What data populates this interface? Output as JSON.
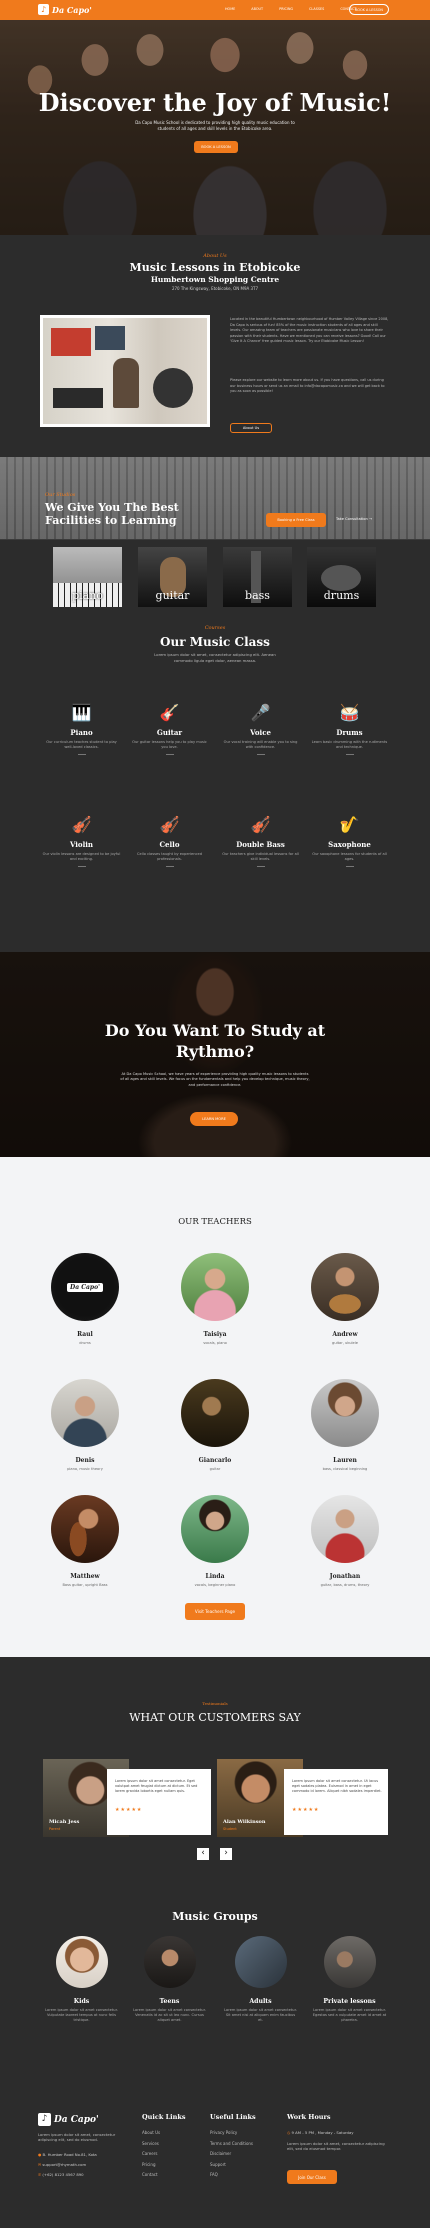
{
  "nav": {
    "logo": "Da Capo'",
    "items": [
      "HOME",
      "ABOUT",
      "PRICING",
      "CLASSES",
      "CONTACT"
    ],
    "cta": "BOOK A LESSON"
  },
  "hero": {
    "title": "Discover the Joy of Music!",
    "subtitle": "Da Capo Music School is dedicated to providing high quality music education to students of all ages and skill levels in the Etobicoke area.",
    "button": "BOOK A LESSON"
  },
  "lessons": {
    "kicker": "About Us",
    "title": "Music Lessons in Etobicoke",
    "subtitle": "Humbertown Shopping Centre",
    "address": "270 The Kingsway, Etobicoke, ON M9A 3T7",
    "para1": "Located in the beautiful Humbertown neighbourhood of Humber Valley Village since 2008, Da Capo is serious of fun! 85% of the music instruction students of all ages and skill levels. Our amazing team of teachers are passionate musicians who love to share their passion with their students. Have we mentioned you can receive lessons? Good! Call our 'Give It A Chance' free guided music lesson. Try our Etobicoke Music Lesson!",
    "para2": "Please explore our website to learn more about us. If you have questions, call us during our business hours or send us an email to info@dacapomusic.ca and we will get back to you as soon as possible!",
    "button": "About Us"
  },
  "facilities": {
    "kicker": "Our Studios",
    "title": "We Give You The Best Facilities to Learning",
    "button": "Booking a Free Class",
    "link": "Take Consultation",
    "cards": [
      "piano",
      "guitar",
      "bass",
      "drums"
    ]
  },
  "music_class": {
    "kicker": "Courses",
    "title": "Our Music Class",
    "desc": "Lorem ipsum dolor sit amet, consectetur adipiscing elit. Aenean commodo ligula eget dolor, aenean massa.",
    "items": [
      {
        "name": "Piano",
        "desc": "Our curriculum teaches student to play well-loved classics.",
        "icon": "piano-icon",
        "glyph": "🎹"
      },
      {
        "name": "Guitar",
        "desc": "Our guitar lessons help you to play music you love.",
        "icon": "guitar-icon",
        "glyph": "🎸"
      },
      {
        "name": "Voice",
        "desc": "Our vocal training will enable you to sing with confidence.",
        "icon": "microphone-icon",
        "glyph": "🎤"
      },
      {
        "name": "Drums",
        "desc": "Learn basic drumming with the rudiments and technique.",
        "icon": "drum-icon",
        "glyph": "🥁"
      },
      {
        "name": "Violin",
        "desc": "Our violin lessons are designed to be joyful and exciting.",
        "icon": "violin-icon",
        "glyph": "🎻"
      },
      {
        "name": "Cello",
        "desc": "Cello classes taught by experienced professionals.",
        "icon": "cello-icon",
        "glyph": "🎻"
      },
      {
        "name": "Double Bass",
        "desc": "Our teachers give individual lessons for all skill levels.",
        "icon": "double-bass-icon",
        "glyph": "🎻"
      },
      {
        "name": "Saxophone",
        "desc": "Our saxophone lessons for students of all ages.",
        "icon": "saxophone-icon",
        "glyph": "🎷"
      }
    ]
  },
  "study": {
    "title": "Do You Want To Study at Rythmo?",
    "desc": "At Da Capo Music School, we have years of experience providing high quality music lessons to students of all ages and skill levels. We focus on the fundamentals and help you develop technique, music theory, and performance confidence.",
    "button": "LEARN MORE"
  },
  "teachers": {
    "title": "OUR TEACHERS",
    "list": [
      {
        "name": "Raul",
        "role": "drums"
      },
      {
        "name": "Taisiya",
        "role": "vocals, piano"
      },
      {
        "name": "Andrew",
        "role": "guitar, ukulele"
      },
      {
        "name": "Denis",
        "role": "piano, music theory"
      },
      {
        "name": "Giancarlo",
        "role": "guitar"
      },
      {
        "name": "Lauren",
        "role": "bass, classical beginning"
      },
      {
        "name": "Matthew",
        "role": "Bass guitar, upright Bass"
      },
      {
        "name": "Linda",
        "role": "vocals, beginner piano"
      },
      {
        "name": "Jonathan",
        "role": "guitar, bass, drums, theory"
      }
    ],
    "button": "Visit Teachers Page"
  },
  "testimonials": {
    "kicker": "Testimonials",
    "title": "WHAT OUR CUSTOMERS SAY",
    "items": [
      {
        "name": "Micah Jess",
        "role": "Parent",
        "text": "Lorem ipsum dolor sit amet consectetur. Eget volutpat amet feugiat dictum at dictum. Et sed lorem gravida lobortis eget nullam quis.",
        "stars": "★★★★★"
      },
      {
        "name": "Alan Wilkinson",
        "role": "Student",
        "text": "Lorem ipsum dolor sit amet consectetur. Ut lacus eget sodales platea. Euismod in amet in eget commodo id lorem. Aliquet nibh sodales imperdiet.",
        "stars": "★★★★★"
      }
    ],
    "prev": "‹",
    "next": "›"
  },
  "groups": {
    "title": "Music Groups",
    "items": [
      {
        "name": "Kids",
        "desc": "Lorem ipsum dolor sit amet consectetur. Vulputate laoreet tempus at nunc felis tristique."
      },
      {
        "name": "Teens",
        "desc": "Lorem ipsum dolor sit amet consectetur. Venenatis id ac sit ut leo nunc. Cursus aliquet amet."
      },
      {
        "name": "Adults",
        "desc": "Lorem ipsum dolor sit amet consectetur. Sit amet nisi at aliquam enim faucibus et."
      },
      {
        "name": "Private lessons",
        "desc": "Lorem ipsum dolor sit amet consectetur. Egestas sed a vulputate amet id amet at pharetra."
      }
    ]
  },
  "footer": {
    "logo": "Da Capo'",
    "about": "Lorem ipsum dolor sit amet, consectetur adipiscing elit, sed do eiusmod.",
    "address": "B. Humber Road No.81, Kota",
    "email": "support@rhymath.com",
    "phone": "(+62) 8123 4567 890",
    "quick_title": "Quick Links",
    "quick": [
      "About Us",
      "Services",
      "Careers",
      "Pricing",
      "Contact"
    ],
    "useful_title": "Useful Links",
    "useful": [
      "Privacy Policy",
      "Terms and Conditions",
      "Disclaimer",
      "Support",
      "FAQ"
    ],
    "hours_title": "Work Hours",
    "hours": "9 AM - 5 PM , Monday - Saturday",
    "hours_desc": "Lorem ipsum dolor sit amet, consectetur adipiscing elit, sed do eiusmod tempor.",
    "button": "Join Our Class"
  },
  "colors": {
    "accent": "#f07a1c",
    "dark": "#2c2c2c",
    "light": "#f3f4f6"
  }
}
